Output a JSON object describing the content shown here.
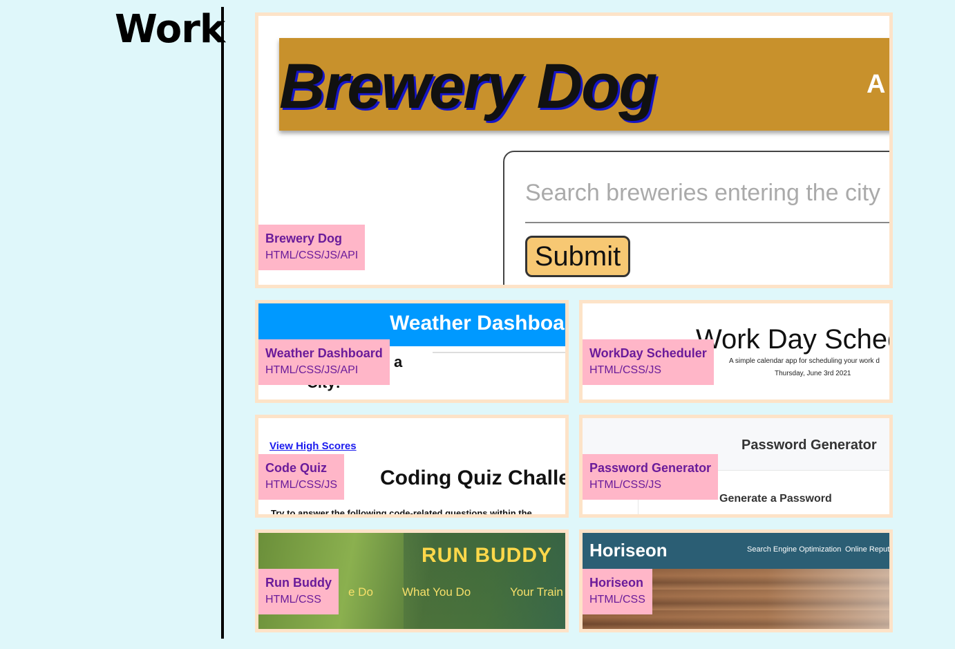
{
  "section": {
    "title": "Work"
  },
  "projects": [
    {
      "name": "Brewery Dog",
      "tech": "HTML/CSS/JS/API",
      "preview": {
        "title": "Brewery Dog",
        "nav_fragment": "A",
        "search_placeholder": "Search breweries entering the city",
        "submit_label": "Submit",
        "banner_color": "#c8912c"
      }
    },
    {
      "name": "Weather Dashboard",
      "tech": "HTML/CSS/JS/API",
      "preview": {
        "title": "Weather Dashboa",
        "fragment_a": "a",
        "fragment_city": "City:",
        "bar_color": "#0099ff"
      }
    },
    {
      "name": "WorkDay Scheduler",
      "tech": "HTML/CSS/JS",
      "preview": {
        "title": "Work Day Sched",
        "subtitle": "A simple calendar app for scheduling your work d",
        "date": "Thursday, June 3rd 2021"
      }
    },
    {
      "name": "Code Quiz",
      "tech": "HTML/CSS/JS",
      "preview": {
        "link": "View High Scores",
        "title": "Coding Quiz Challer",
        "text": "Try to answer the following code-related questions within the"
      }
    },
    {
      "name": "Password Generator",
      "tech": "HTML/CSS/JS",
      "preview": {
        "title": "Password Generator",
        "subtitle": "Generate a Password"
      }
    },
    {
      "name": "Run Buddy",
      "tech": "HTML/CSS",
      "preview": {
        "title": "RUN BUDDY",
        "nav": [
          "e Do",
          "What You Do",
          "Your Train"
        ]
      }
    },
    {
      "name": "Horiseon",
      "tech": "HTML/CSS",
      "preview": {
        "logo": "Horiseon",
        "nav": [
          "Search Engine Optimization",
          "Online Reputa"
        ],
        "bar_color": "#2b5e74"
      }
    }
  ],
  "colors": {
    "background": "#dff7fa",
    "card_border": "#fde3c8",
    "label_bg": "#ffb6c8",
    "label_text": "#6a1b9a"
  }
}
